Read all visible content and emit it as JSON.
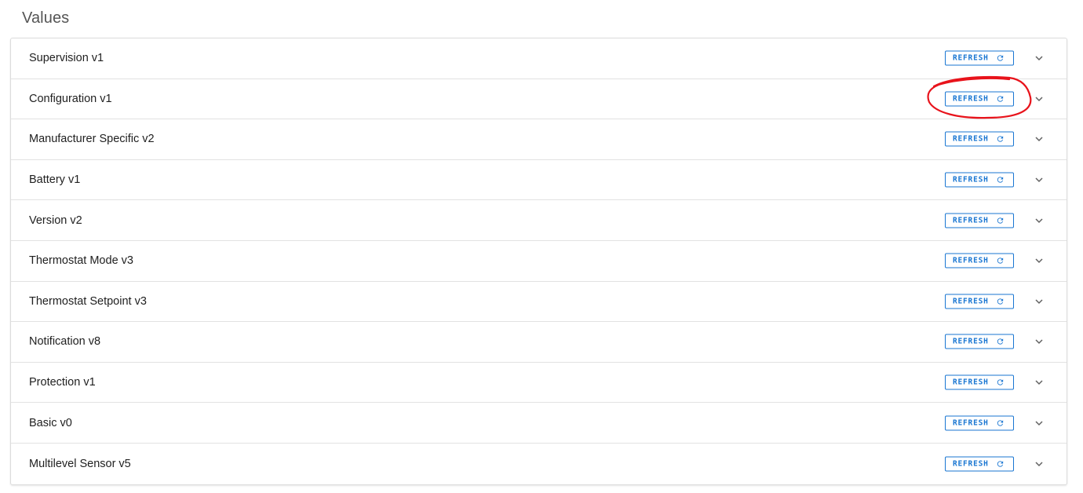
{
  "section": {
    "title": "Values"
  },
  "button_label": "REFRESH",
  "accent_color": "#1976d2",
  "annotation_color": "#e8131b",
  "rows": [
    {
      "label": "Supervision v1",
      "refresh_label": "REFRESH"
    },
    {
      "label": "Configuration v1",
      "refresh_label": "REFRESH"
    },
    {
      "label": "Manufacturer Specific v2",
      "refresh_label": "REFRESH"
    },
    {
      "label": "Battery v1",
      "refresh_label": "REFRESH"
    },
    {
      "label": "Version v2",
      "refresh_label": "REFRESH"
    },
    {
      "label": "Thermostat Mode v3",
      "refresh_label": "REFRESH"
    },
    {
      "label": "Thermostat Setpoint v3",
      "refresh_label": "REFRESH"
    },
    {
      "label": "Notification v8",
      "refresh_label": "REFRESH"
    },
    {
      "label": "Protection v1",
      "refresh_label": "REFRESH"
    },
    {
      "label": "Basic v0",
      "refresh_label": "REFRESH"
    },
    {
      "label": "Multilevel Sensor v5",
      "refresh_label": "REFRESH"
    }
  ],
  "icons": {
    "refresh": "refresh-icon",
    "expand": "chevron-down-icon"
  }
}
